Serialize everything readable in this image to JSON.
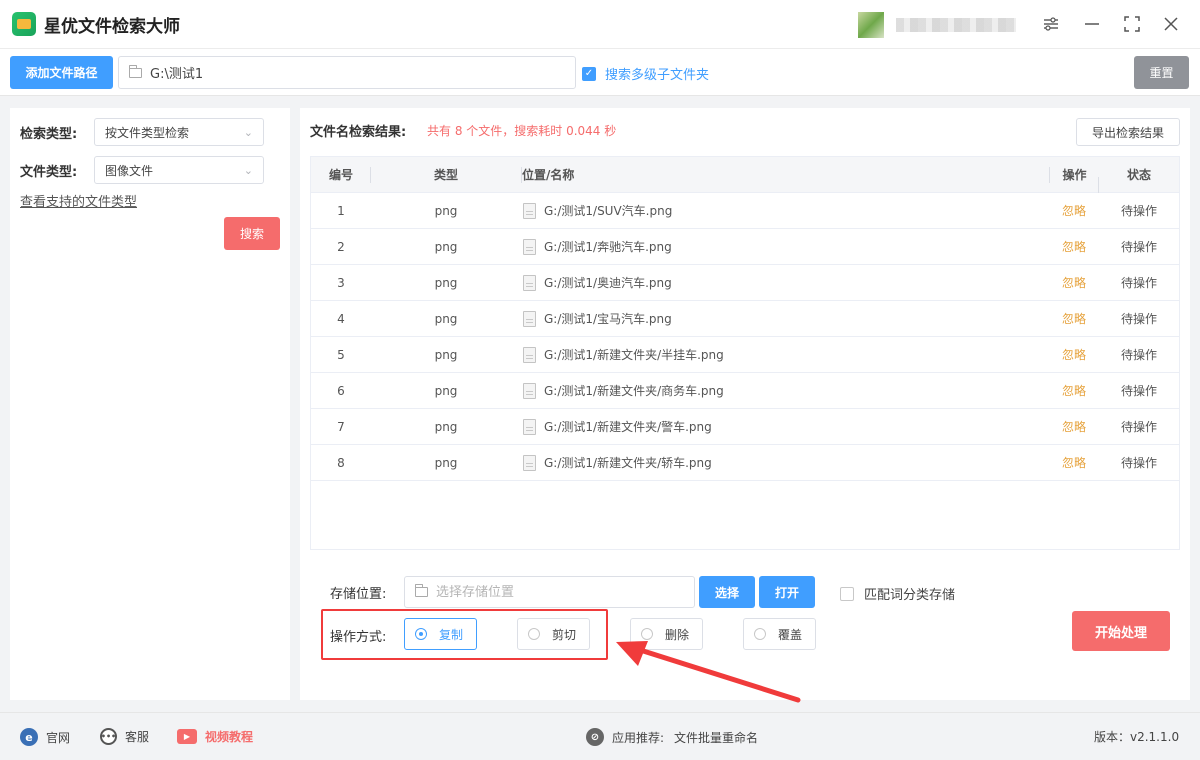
{
  "app": {
    "title": "星优文件检索大师"
  },
  "toolbar": {
    "add_path_label": "添加文件路径",
    "path_value": "G:\\测试1",
    "subfolder_label": "搜索多级子文件夹",
    "reset_label": "重置"
  },
  "search": {
    "type_label": "检索类型:",
    "type_value": "按文件类型检索",
    "file_type_label": "文件类型:",
    "file_type_value": "图像文件",
    "supported_link": "查看支持的文件类型",
    "search_label": "搜索"
  },
  "results": {
    "title": "文件名检索结果:",
    "summary": "共有 8 个文件，搜索耗时 0.044 秒",
    "export_label": "导出检索结果",
    "columns": [
      "编号",
      "类型",
      "位置/名称",
      "操作",
      "状态"
    ],
    "rows": [
      {
        "no": "1",
        "type": "png",
        "path": "G:/测试1/SUV汽车.png",
        "op": "忽略",
        "status": "待操作"
      },
      {
        "no": "2",
        "type": "png",
        "path": "G:/测试1/奔驰汽车.png",
        "op": "忽略",
        "status": "待操作"
      },
      {
        "no": "3",
        "type": "png",
        "path": "G:/测试1/奥迪汽车.png",
        "op": "忽略",
        "status": "待操作"
      },
      {
        "no": "4",
        "type": "png",
        "path": "G:/测试1/宝马汽车.png",
        "op": "忽略",
        "status": "待操作"
      },
      {
        "no": "5",
        "type": "png",
        "path": "G:/测试1/新建文件夹/半挂车.png",
        "op": "忽略",
        "status": "待操作"
      },
      {
        "no": "6",
        "type": "png",
        "path": "G:/测试1/新建文件夹/商务车.png",
        "op": "忽略",
        "status": "待操作"
      },
      {
        "no": "7",
        "type": "png",
        "path": "G:/测试1/新建文件夹/警车.png",
        "op": "忽略",
        "status": "待操作"
      },
      {
        "no": "8",
        "type": "png",
        "path": "G:/测试1/新建文件夹/轿车.png",
        "op": "忽略",
        "status": "待操作"
      }
    ]
  },
  "storage": {
    "label": "存储位置:",
    "placeholder": "选择存储位置",
    "choose_label": "选择",
    "open_label": "打开",
    "match_label": "匹配词分类存储"
  },
  "operation": {
    "label": "操作方式:",
    "options": [
      "复制",
      "剪切",
      "删除",
      "覆盖"
    ],
    "selected": "复制",
    "start_label": "开始处理"
  },
  "footer": {
    "website": "官网",
    "support": "客服",
    "video": "视频教程",
    "recommend_label": "应用推荐:",
    "recommend_app": "文件批量重命名",
    "version": "版本：v2.1.1.0"
  },
  "colors": {
    "primary": "#409eff",
    "danger": "#f56c6c",
    "warning": "#e6a23c",
    "highlight": "#f03b3b"
  },
  "icons": [
    "app-logo-icon",
    "folder-icon",
    "checkbox-checked-icon",
    "chevron-down-icon",
    "file-icon",
    "radio-icon",
    "settings-icon",
    "minimize-icon",
    "maximize-icon",
    "close-icon",
    "ie-icon",
    "chat-icon",
    "video-icon",
    "link-icon"
  ]
}
